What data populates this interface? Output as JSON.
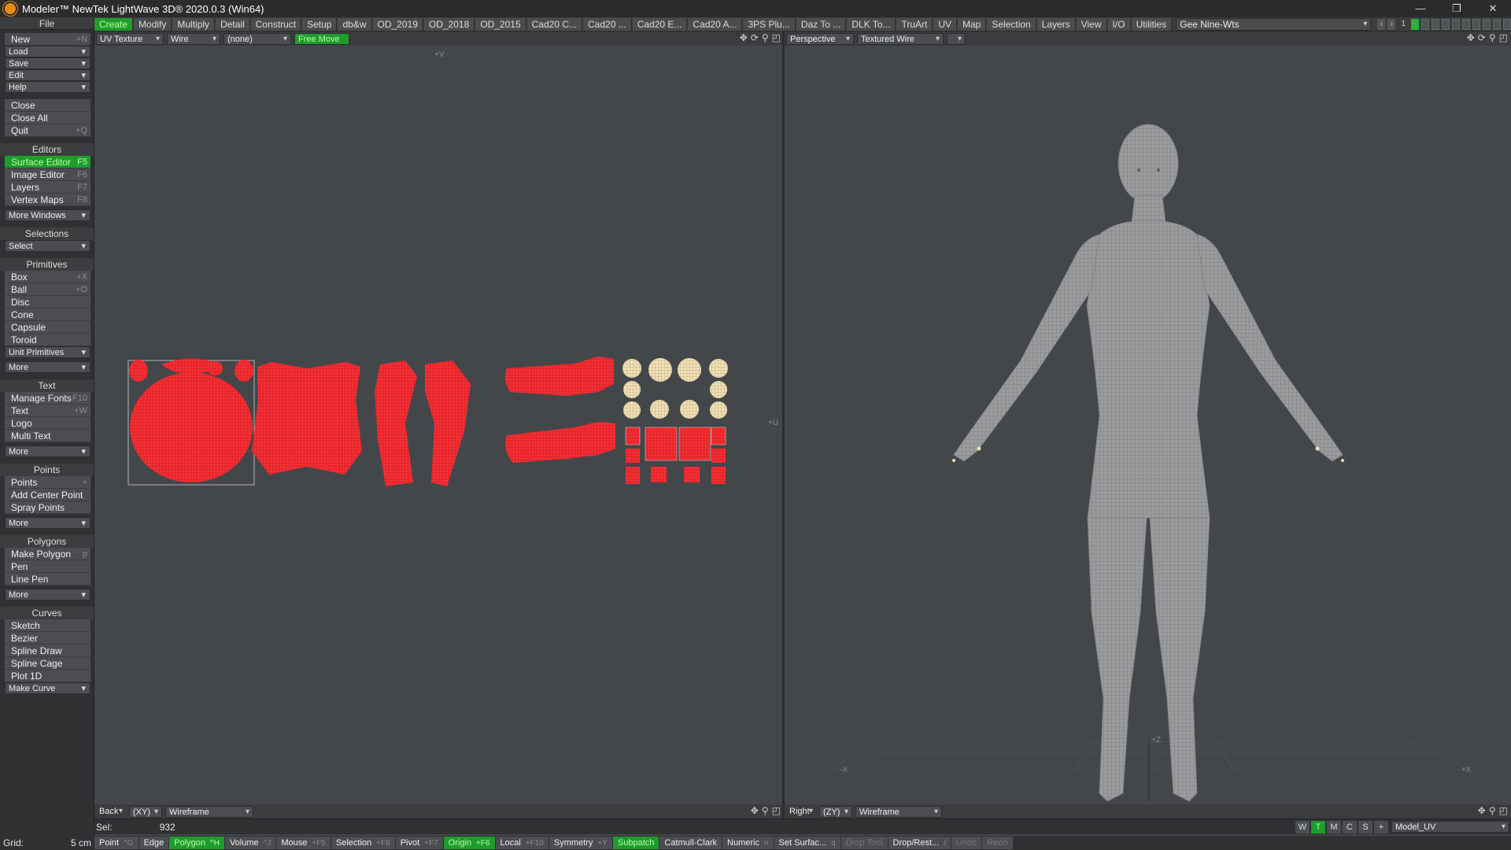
{
  "window": {
    "title": "Modeler™ NewTek LightWave 3D® 2020.0.3 (Win64)",
    "minimize": "—",
    "restore": "❐",
    "close": "✕"
  },
  "tabs": [
    "Create",
    "Modify",
    "Multiply",
    "Detail",
    "Construct",
    "Setup",
    "db&w",
    "OD_2019",
    "OD_2018",
    "OD_2015",
    "Cad20 C...",
    "Cad20 ...",
    "Cad20 E...",
    "Cad20 A...",
    "3PS Plu...",
    "Daz To ...",
    "DLK To...",
    "TruArt",
    "UV",
    "Map",
    "Selection",
    "Layers",
    "View",
    "I/O",
    "Utilities"
  ],
  "tab_selector": "Gee Nine-Wts",
  "layer_number": "1",
  "sidebar": {
    "file_header": "File",
    "file_items": [
      {
        "label": "New",
        "shortcut": "+N"
      },
      {
        "label": "Load",
        "dropdown": true
      },
      {
        "label": "Save",
        "dropdown": true
      },
      {
        "label": "Edit",
        "dropdown": true
      },
      {
        "label": "Help",
        "dropdown": true
      }
    ],
    "file_items2": [
      {
        "label": "Close",
        "shortcut": ""
      },
      {
        "label": "Close All",
        "shortcut": ""
      },
      {
        "label": "Quit",
        "shortcut": "+Q"
      }
    ],
    "editors_header": "Editors",
    "editors": [
      {
        "label": "Surface Editor",
        "shortcut": "F5"
      },
      {
        "label": "Image Editor",
        "shortcut": "F6"
      },
      {
        "label": "Layers",
        "shortcut": "F7"
      },
      {
        "label": "Vertex Maps",
        "shortcut": "F8"
      }
    ],
    "more_windows": "More Windows",
    "selections_header": "Selections",
    "select": "Select",
    "primitives_header": "Primitives",
    "primitives": [
      {
        "label": "Box",
        "shortcut": "+X"
      },
      {
        "label": "Ball",
        "shortcut": "+O"
      },
      {
        "label": "Disc",
        "shortcut": ""
      },
      {
        "label": "Cone",
        "shortcut": ""
      },
      {
        "label": "Capsule",
        "shortcut": ""
      },
      {
        "label": "Toroid",
        "shortcut": ""
      }
    ],
    "unit_primitives": "Unit Primitives",
    "more1": "More",
    "text_header": "Text",
    "text_items": [
      {
        "label": "Manage Fonts",
        "shortcut": "F10"
      },
      {
        "label": "Text",
        "shortcut": "+W"
      },
      {
        "label": "Logo",
        "shortcut": ""
      },
      {
        "label": "Multi Text",
        "shortcut": ""
      }
    ],
    "more2": "More",
    "points_header": "Points",
    "points_items": [
      {
        "label": "Points",
        "shortcut": "+"
      },
      {
        "label": "Add Center Point",
        "shortcut": ""
      },
      {
        "label": "Spray Points",
        "shortcut": ""
      }
    ],
    "more3": "More",
    "polygons_header": "Polygons",
    "polygons_items": [
      {
        "label": "Make Polygon",
        "shortcut": "p"
      },
      {
        "label": "Pen",
        "shortcut": ""
      },
      {
        "label": "Line Pen",
        "shortcut": ""
      }
    ],
    "more4": "More",
    "curves_header": "Curves",
    "curves_items": [
      {
        "label": "Sketch",
        "shortcut": ""
      },
      {
        "label": "Bezier",
        "shortcut": ""
      },
      {
        "label": "Spline Draw",
        "shortcut": ""
      },
      {
        "label": "Spline Cage",
        "shortcut": ""
      },
      {
        "label": "Plot 1D",
        "shortcut": ""
      }
    ],
    "make_curve": "Make Curve"
  },
  "left_viewport": {
    "view": "UV Texture",
    "mode": "Wire",
    "map": "(none)",
    "tool": "Free Move",
    "axis_v": "+V",
    "axis_u": "+U",
    "bottom_view": "Back",
    "bottom_axes": "(XY)",
    "bottom_mode": "Wireframe"
  },
  "right_viewport": {
    "view": "Perspective",
    "mode": "Textured Wire",
    "bottom_view": "Right",
    "bottom_axes": "(ZY)",
    "bottom_mode": "Wireframe",
    "axis_z": "+Z",
    "axis_x": "+X",
    "axis_nx": "-X"
  },
  "status": {
    "sel_label": "Sel:",
    "sel_value": "932",
    "grid_label": "Grid:",
    "grid_value": "5 cm",
    "buttons": [
      {
        "label": "Point",
        "key": "^G",
        "active": false
      },
      {
        "label": "Edge",
        "key": "",
        "active": false
      },
      {
        "label": "Polygon",
        "key": "^H",
        "active": true
      },
      {
        "label": "Volume",
        "key": "^J",
        "active": false
      },
      {
        "label": "Mouse",
        "key": "+F5",
        "active": false
      },
      {
        "label": "Selection",
        "key": "+F8",
        "active": false
      },
      {
        "label": "Pivot",
        "key": "+F7",
        "active": false
      },
      {
        "label": "Origin",
        "key": "+F6",
        "active": true
      },
      {
        "label": "Local",
        "key": "+F10",
        "active": false
      },
      {
        "label": "Symmetry",
        "key": "+Y",
        "active": false
      },
      {
        "label": "Subpatch",
        "key": "",
        "active": true
      },
      {
        "label": "Catmull-Clark",
        "key": "",
        "active": false
      },
      {
        "label": "Numeric",
        "key": "n",
        "active": false
      },
      {
        "label": "Set Surfac...",
        "key": "q",
        "active": false
      },
      {
        "label": "Drop Tool",
        "key": "",
        "active": false,
        "dim": true
      },
      {
        "label": "Drop/Rest...",
        "key": "/",
        "active": false
      },
      {
        "label": "Undo",
        "key": "",
        "active": false,
        "dim": true
      },
      {
        "label": "Redo",
        "key": "",
        "active": false,
        "dim": true
      }
    ],
    "wtmcs": [
      "W",
      "T",
      "M",
      "C",
      "S",
      "+"
    ],
    "model_uv": "Model_UV"
  },
  "colors": {
    "accent_green": "#1f9c2e",
    "uv_red": "#e8242a",
    "uv_cream": "#f1e0b5"
  }
}
